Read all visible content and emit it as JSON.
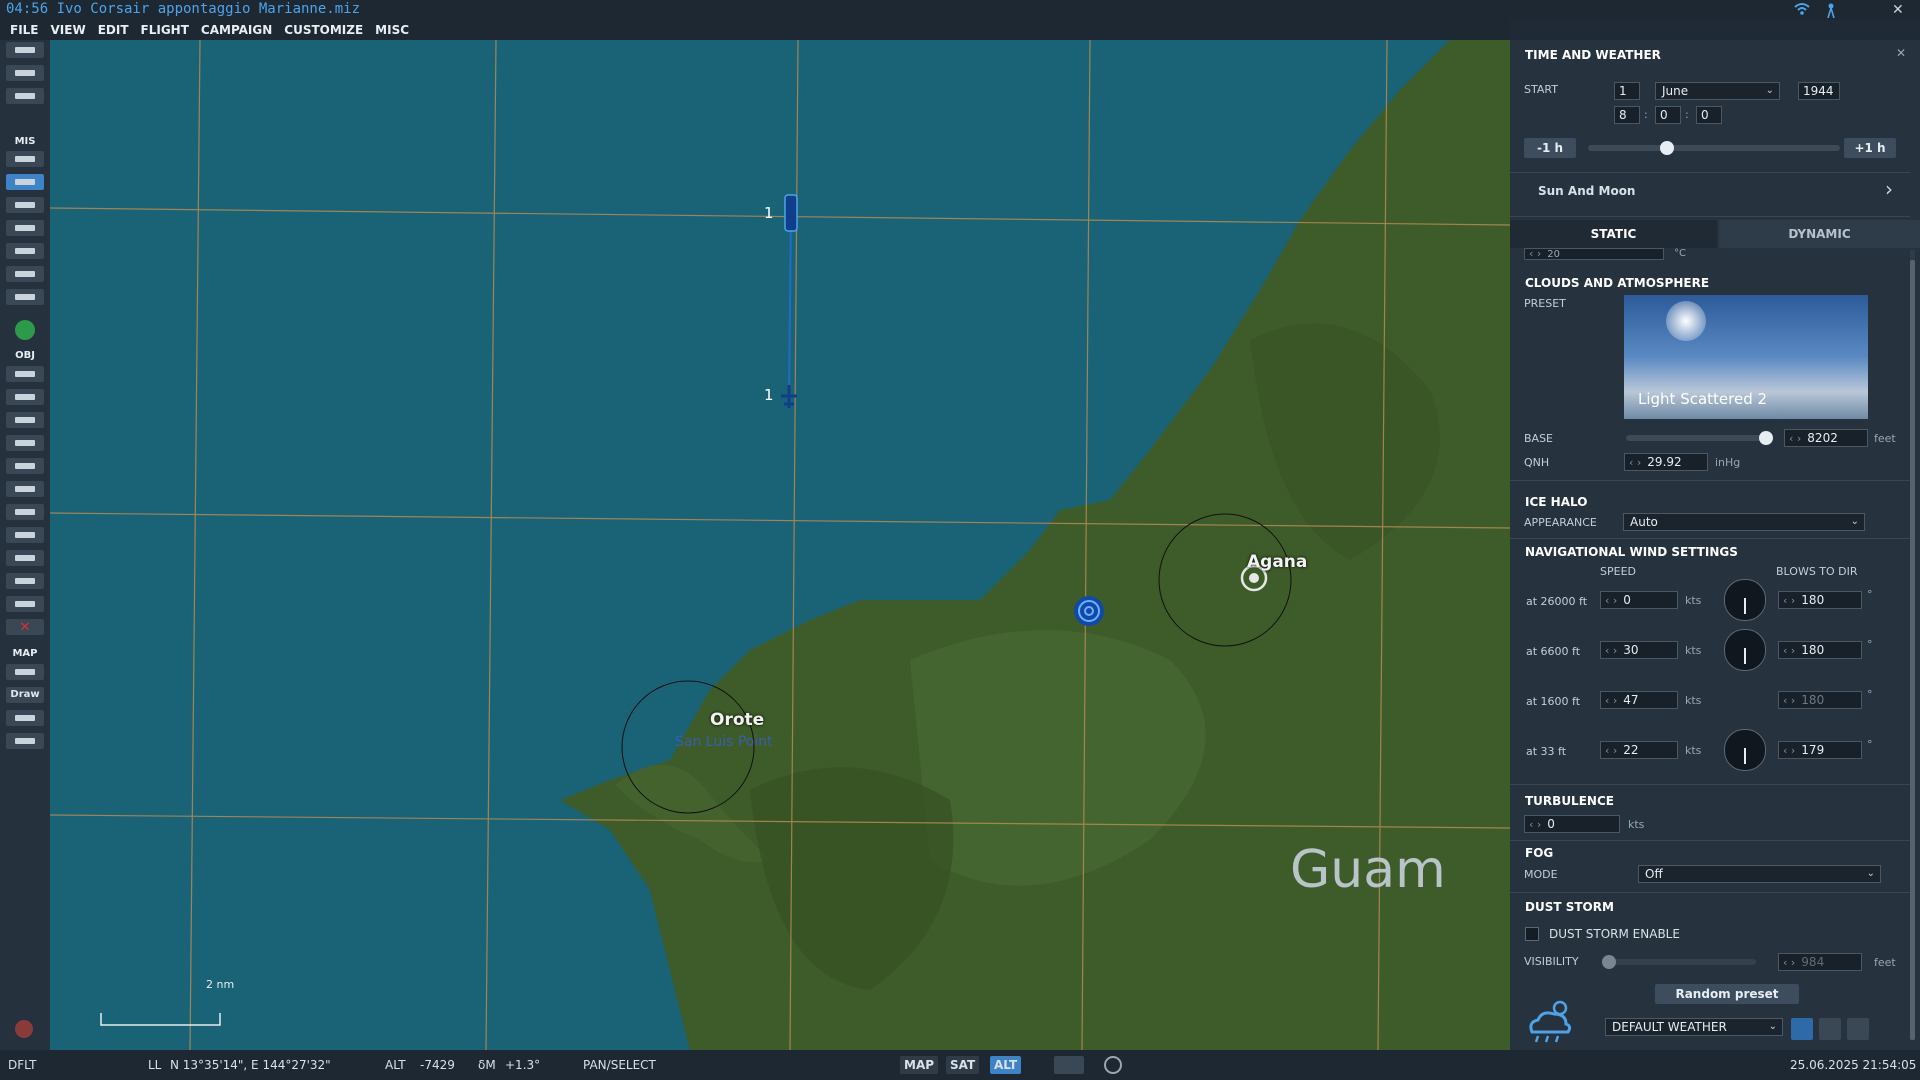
{
  "window": {
    "title": "04:56 Ivo Corsair appontaggio Marianne.miz"
  },
  "menu": [
    "FILE",
    "VIEW",
    "EDIT",
    "FLIGHT",
    "CAMPAIGN",
    "CUSTOMIZE",
    "MISC"
  ],
  "toolbar": {
    "sections": {
      "mis": "MIS",
      "obj": "OBJ",
      "map": "MAP"
    },
    "draw_label": "Draw"
  },
  "map": {
    "labels": {
      "orote": "Orote",
      "agana": "Agana",
      "guam": "Guam",
      "san_luis": "San Luis Point"
    },
    "waypoints": [
      {
        "label": "1"
      },
      {
        "label": "1"
      }
    ],
    "scale_label": "2 nm",
    "colors": {
      "sea": "#1a6377",
      "land": "#3e5c2a",
      "grid": "#b58b55",
      "route": "#1e6cc9"
    }
  },
  "panel": {
    "title": "TIME AND WEATHER",
    "start": {
      "label": "START",
      "day": "1",
      "month": "June",
      "year": "1944",
      "hour": "8",
      "minute": "0",
      "second": "0",
      "minus_label": "-1 h",
      "plus_label": "+1 h"
    },
    "sun_moon": "Sun And Moon",
    "tabs": {
      "static": "STATIC",
      "dynamic": "DYNAMIC"
    },
    "temperature": {
      "value": "20",
      "unit": "°C"
    },
    "clouds": {
      "title": "CLOUDS AND ATMOSPHERE",
      "preset_label": "PRESET",
      "preset_name": "Light Scattered 2",
      "base_label": "BASE",
      "base_value": "8202",
      "base_unit": "feet",
      "qnh_label": "QNH",
      "qnh_value": "29.92",
      "qnh_unit": "inHg"
    },
    "ice_halo": {
      "title": "ICE HALO",
      "appearance_label": "APPEARANCE",
      "appearance_value": "Auto"
    },
    "wind": {
      "title": "NAVIGATIONAL WIND SETTINGS",
      "speed_header": "SPEED",
      "dir_header": "BLOWS TO DIR",
      "rows": [
        {
          "label": "at 26000 ft",
          "speed": "0",
          "unit": "kts",
          "dir": "180",
          "deg": "°"
        },
        {
          "label": "at 6600 ft",
          "speed": "30",
          "unit": "kts",
          "dir": "180",
          "deg": "°"
        },
        {
          "label": "at 1600 ft",
          "speed": "47",
          "unit": "kts",
          "dir": "180",
          "deg": "°"
        },
        {
          "label": "at 33 ft",
          "speed": "22",
          "unit": "kts",
          "dir": "179",
          "deg": "°"
        }
      ]
    },
    "turbulence": {
      "title": "TURBULENCE",
      "value": "0",
      "unit": "kts"
    },
    "fog": {
      "title": "FOG",
      "mode_label": "MODE",
      "mode_value": "Off"
    },
    "dust": {
      "title": "DUST STORM",
      "enable_label": "DUST STORM ENABLE",
      "visibility_label": "VISIBILITY",
      "visibility_value": "984",
      "visibility_unit": "feet"
    },
    "random_preset": "Random preset",
    "weather_preset": "DEFAULT WEATHER"
  },
  "status": {
    "profile": "DFLT",
    "coords_label": "LL",
    "coords": "N 13°35'14\", E 144°27'32\"",
    "alt_label": "ALT",
    "alt_value": "-7429",
    "mag_label": "δM",
    "mag_value": "+1.3°",
    "mode": "PAN/SELECT",
    "btn_map": "MAP",
    "btn_sat": "SAT",
    "btn_alt": "ALT",
    "datetime": "25.06.2025 21:54:05"
  }
}
